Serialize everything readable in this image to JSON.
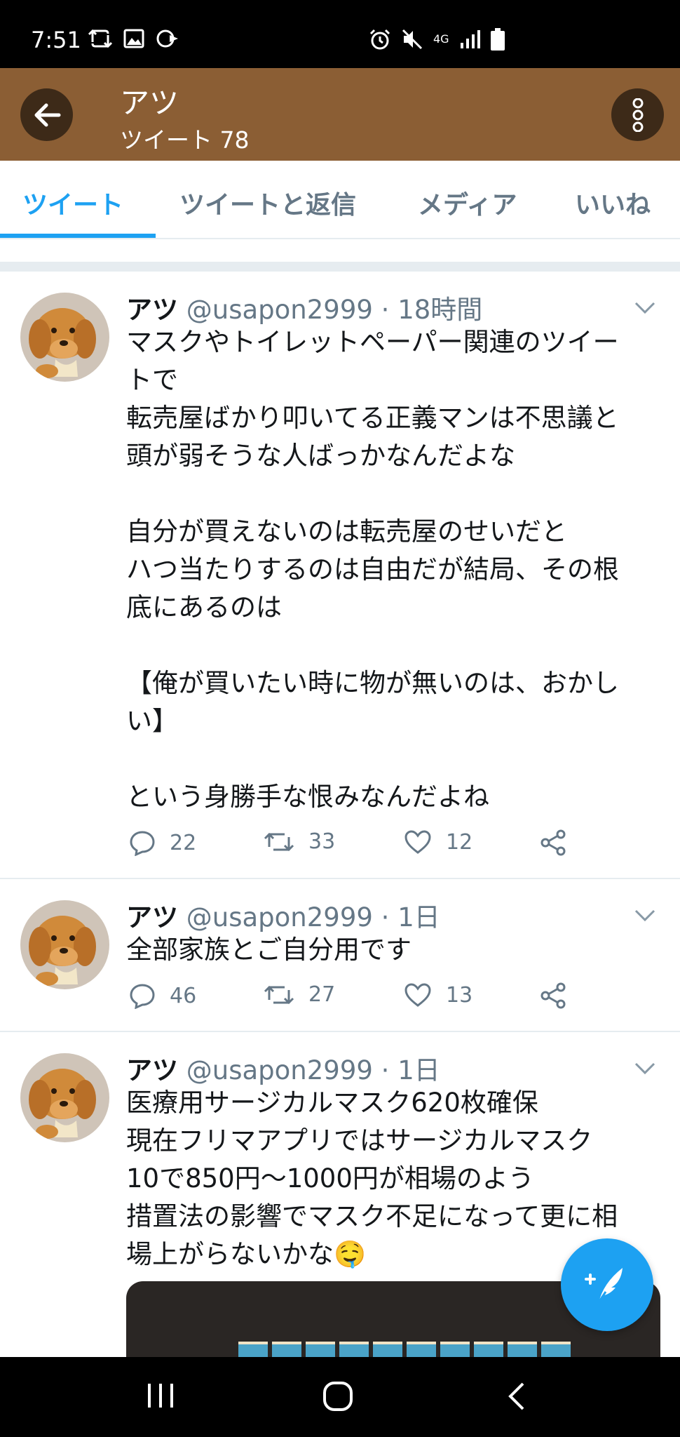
{
  "status_bar": {
    "time": "7:51",
    "left_icons": [
      "retweet-icon",
      "image-icon",
      "cast-icon"
    ],
    "right_icons": [
      "alarm-icon",
      "mute-icon",
      "network-4g-icon",
      "signal-icon",
      "battery-icon"
    ],
    "network_label": "4G"
  },
  "header": {
    "title": "アツ",
    "subtitle": "ツイート 78"
  },
  "tabs": [
    {
      "label": "ツイート",
      "active": true
    },
    {
      "label": "ツイートと返信",
      "active": false
    },
    {
      "label": "メディア",
      "active": false
    },
    {
      "label": "いいね",
      "active": false
    }
  ],
  "tweets": [
    {
      "name": "アツ",
      "handle": "@usapon2999",
      "separator": "·",
      "time": "18時間",
      "text": "マスクやトイレットペーパー関連のツイー\nトで\n転売屋ばかり叩いてる正義マンは不思議と\n頭が弱そうな人ばっかなんだよな\n\n自分が買えないのは転売屋のせいだと\nハつ当たりするのは自由だが結局、その根\n底にあるのは\n\n【俺が買いたい時に物が無いのは、おかし\nい】\n\nという身勝手な恨みなんだよね",
      "replies": "22",
      "retweets": "33",
      "likes": "12"
    },
    {
      "name": "アツ",
      "handle": "@usapon2999",
      "separator": "·",
      "time": "1日",
      "text": "全部家族とご自分用です",
      "replies": "46",
      "retweets": "27",
      "likes": "13"
    },
    {
      "name": "アツ",
      "handle": "@usapon2999",
      "separator": "·",
      "time": "1日",
      "text": "医療用サージカルマスク620枚確保\n現在フリマアプリではサージカルマスク\n10で850円〜1000円が相場のよう\n措置法の影響でマスク不足になって更に相\n場上がらないかな🤤"
    }
  ],
  "colors": {
    "header_bg": "#8b5e34",
    "accent": "#1da1f2",
    "secondary_text": "#657786"
  }
}
